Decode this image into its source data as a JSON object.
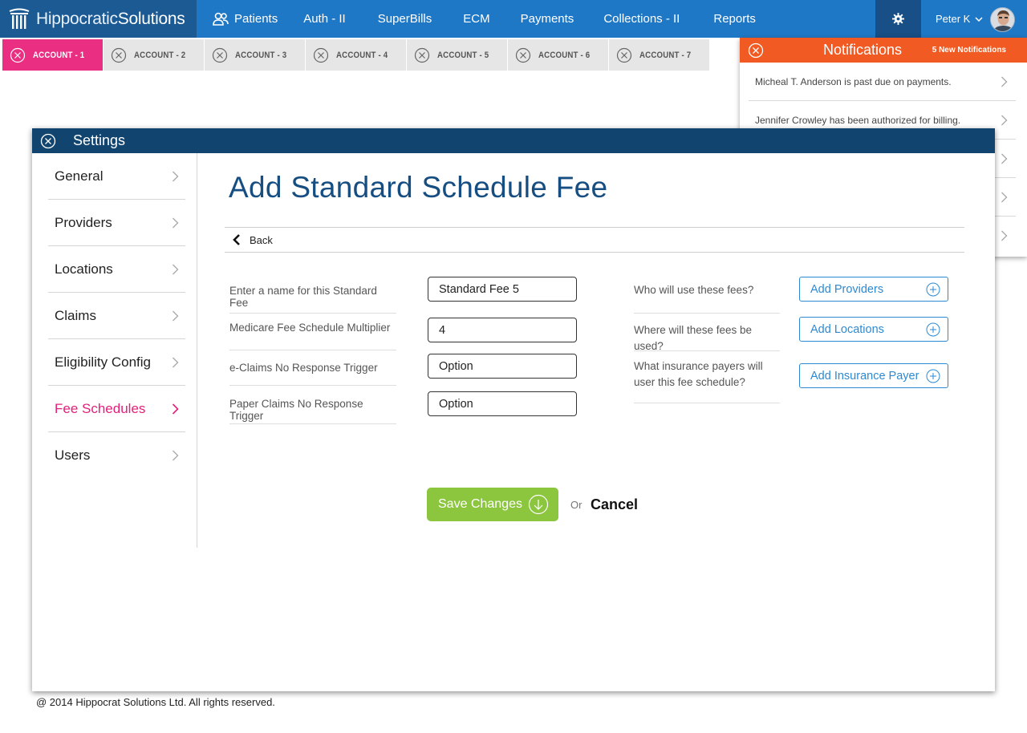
{
  "brand": {
    "name_light": "Hippocratic",
    "name_bold": "Solutions",
    "logo_icon": "column-logo-icon"
  },
  "nav": {
    "items": [
      {
        "label": "Patients",
        "icon": "patients-icon"
      },
      {
        "label": "Auth - II"
      },
      {
        "label": "SuperBills"
      },
      {
        "label": "ECM"
      },
      {
        "label": "Payments"
      },
      {
        "label": "Collections - II"
      },
      {
        "label": "Reports"
      }
    ],
    "settings_icon": "gear-icon",
    "user_name": "Peter K"
  },
  "tabs": [
    {
      "label": "ACCOUNT - 1",
      "active": true
    },
    {
      "label": "ACCOUNT - 2"
    },
    {
      "label": "ACCOUNT - 3"
    },
    {
      "label": "ACCOUNT - 4"
    },
    {
      "label": "ACCOUNT - 5"
    },
    {
      "label": "ACCOUNT - 6"
    },
    {
      "label": "ACCOUNT - 7"
    }
  ],
  "notifications": {
    "title": "Notifications",
    "count_label": "5 New Notifications",
    "items": [
      "Micheal T. Anderson is past due on payments.",
      "Jennifer Crowley has been authorized for billing.",
      "",
      "",
      ""
    ]
  },
  "settings": {
    "title": "Settings",
    "sidebar": [
      {
        "label": "General"
      },
      {
        "label": "Providers"
      },
      {
        "label": "Locations"
      },
      {
        "label": "Claims"
      },
      {
        "label": "Eligibility Config"
      },
      {
        "label": "Fee Schedules",
        "active": true
      },
      {
        "label": "Users"
      }
    ],
    "page_title": "Add Standard Schedule Fee",
    "back_label": "Back",
    "left_fields": [
      {
        "label": "Enter a name for this Standard Fee",
        "value": "Standard Fee 5"
      },
      {
        "label": "Medicare Fee Schedule Multiplier",
        "value": "4"
      },
      {
        "label": "e-Claims No Response Trigger",
        "value": "Option"
      },
      {
        "label": "Paper Claims No Response Trigger",
        "value": "Option"
      }
    ],
    "right_fields": [
      {
        "label": "Who will use these fees?",
        "button": "Add Providers"
      },
      {
        "label": "Where will these fees be used?",
        "button": "Add Locations"
      },
      {
        "label": "What insurance payers will user this fee schedule?",
        "button": "Add Insurance Payer"
      }
    ],
    "save_label": "Save Changes",
    "or_label": "Or",
    "cancel_label": "Cancel"
  },
  "footer": "@ 2014 Hippocrat Solutions Ltd. All rights reserved.",
  "colors": {
    "nav_blue": "#1f78c6",
    "brand_blue": "#1b5a93",
    "active_tab_pink": "#ea2f82",
    "notification_orange": "#f15a22",
    "settings_header": "#11456f",
    "active_menu_pink": "#e4207b",
    "save_green": "#8cc63f",
    "link_blue": "#2d8ad2"
  }
}
